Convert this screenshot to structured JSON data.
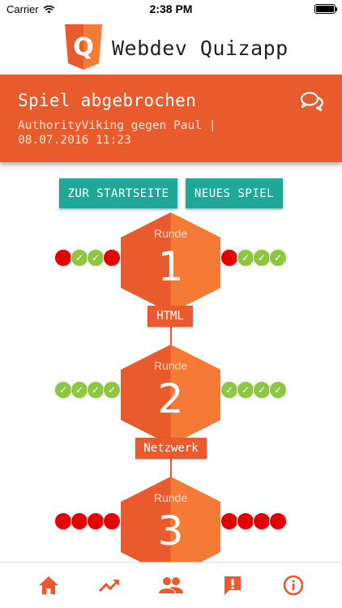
{
  "status_bar": {
    "carrier": "Carrier",
    "time": "2:38 PM"
  },
  "app": {
    "title": "Webdev Quizapp",
    "logo_letter": "Q"
  },
  "banner": {
    "title": "Spiel abgebrochen",
    "subtitle": "AuthorityViking gegen Paul | 08.07.2016 11:23"
  },
  "buttons": {
    "home": "ZUR STARTSEITE",
    "new_game": "NEUES SPIEL"
  },
  "rounds": [
    {
      "label": "Runde",
      "number": "1",
      "category": "HTML",
      "left": [
        "red",
        "green",
        "green",
        "red"
      ],
      "right": [
        "red",
        "green",
        "green",
        "green"
      ]
    },
    {
      "label": "Runde",
      "number": "2",
      "category": "Netzwerk",
      "left": [
        "green",
        "green",
        "green",
        "green"
      ],
      "right": [
        "green",
        "green",
        "green",
        "green"
      ]
    },
    {
      "label": "Runde",
      "number": "3",
      "category": "",
      "left": [
        "red",
        "red",
        "red",
        "red"
      ],
      "right": [
        "red",
        "red",
        "red",
        "red"
      ]
    }
  ],
  "colors": {
    "accent": "#e95a2c",
    "teal": "#1fa79a",
    "correct": "#8ec541",
    "wrong": "#e40000"
  },
  "tabs": [
    "home-icon",
    "trending-icon",
    "people-icon",
    "report-icon",
    "info-icon"
  ]
}
